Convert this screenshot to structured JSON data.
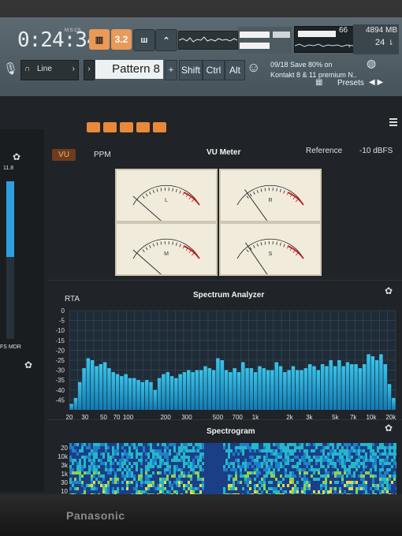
{
  "transport": {
    "time": "0:24:34",
    "time_units": "M:S:CS",
    "tempo_label": "3.2",
    "memory": "4894 MB",
    "cpu_top": "66",
    "polyphony": "24"
  },
  "toolbar": {
    "input_label": "Line",
    "pattern_label": "Pattern 8",
    "plus": "+",
    "shift": "Shift",
    "ctrl": "Ctrl",
    "alt": "Alt",
    "hint_line1": "09/18  Save 80% on",
    "hint_line2": "Kontakt 8 & 11 premium N..",
    "presets": "Presets"
  },
  "plugin": {
    "tab_vu": "VU",
    "tab_ppm": "PPM",
    "vu_title": "VU Meter",
    "reference_label": "Reference",
    "reference_value": "-10 dBFS",
    "meters": [
      {
        "label": "L",
        "needle": -0.85
      },
      {
        "label": "R",
        "needle": -0.62
      },
      {
        "label": "M",
        "needle": -0.85
      },
      {
        "label": "S",
        "needle": -0.6
      }
    ],
    "rta_label": "RTA",
    "spectrum_title": "Spectrum Analyzer",
    "spectrogram_title": "Spectrogram",
    "left_value": "11.8",
    "left_mode": "FS MDR",
    "left_r": "R"
  },
  "colors": {
    "accent": "#e8893a",
    "bar_top": "#39c4ea",
    "bar_bottom": "#127bb4"
  },
  "chart_data": {
    "type": "bar",
    "title": "Spectrum Analyzer",
    "xlabel": "",
    "ylabel": "",
    "ylim": [
      -50,
      0
    ],
    "yticks": [
      "0",
      "-5",
      "-10",
      "-15",
      "-20",
      "-25",
      "-30",
      "-35",
      "-40",
      "-45"
    ],
    "xticks": [
      "20",
      "30",
      "50",
      "70",
      "100",
      "200",
      "300",
      "500",
      "700",
      "1k",
      "2k",
      "3k",
      "5k",
      "7k",
      "10k",
      "20k"
    ],
    "values": [
      -47,
      -44,
      -36,
      -29,
      -24,
      -25,
      -28,
      -27,
      -26,
      -29,
      -31,
      -32,
      -33,
      -32,
      -34,
      -34,
      -35,
      -36,
      -35,
      -36,
      -40,
      -34,
      -32,
      -31,
      -33,
      -34,
      -32,
      -31,
      -30,
      -31,
      -30,
      -30,
      -28,
      -29,
      -30,
      -24,
      -25,
      -30,
      -31,
      -29,
      -31,
      -26,
      -29,
      -29,
      -31,
      -28,
      -29,
      -30,
      -30,
      -26,
      -28,
      -31,
      -30,
      -28,
      -30,
      -30,
      -29,
      -27,
      -28,
      -30,
      -27,
      -28,
      -25,
      -28,
      -25,
      -28,
      -26,
      -27,
      -27,
      -29,
      -27,
      -22,
      -23,
      -25,
      -22,
      -27,
      -37,
      -44
    ]
  },
  "spectrogram": {
    "yticks": [
      "20",
      "10k",
      "3k",
      "1k",
      "30",
      "10"
    ]
  }
}
